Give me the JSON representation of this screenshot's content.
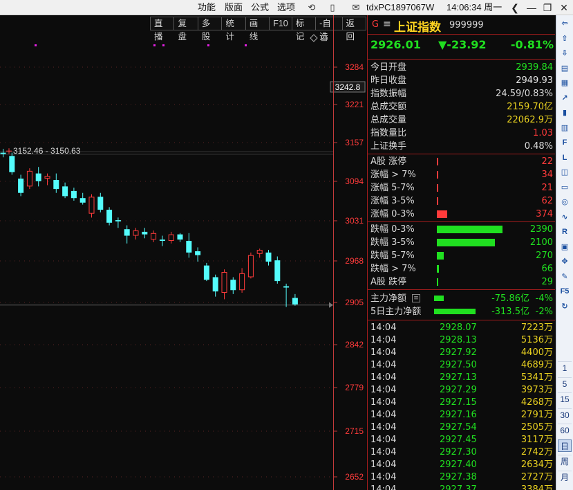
{
  "topbar": {
    "menus": [
      "功能",
      "版面",
      "公式",
      "选项"
    ],
    "account": "tdxPC1897067W",
    "clock": "14:06:34 周一"
  },
  "toolbar": [
    "直播",
    "复盘",
    "多股",
    "统计",
    "画线",
    "F10",
    "标记",
    "-自选",
    "返回"
  ],
  "chart": {
    "price_label": "3152.46 - 3150.63",
    "current_price_tag": "3242.8",
    "y_ticks": [
      "3284",
      "3221",
      "3157",
      "3094",
      "3031",
      "2968",
      "2905",
      "2842",
      "2779",
      "2715",
      "2652"
    ]
  },
  "chart_data": {
    "type": "candlestick",
    "title": "",
    "ylim": [
      2630,
      3330
    ],
    "y_ticks": [
      3284,
      3221,
      3157,
      3094,
      3031,
      2968,
      2905,
      2842,
      2779,
      2715,
      2652
    ],
    "reference_lines": [
      3152.46,
      3150.63,
      2917
    ],
    "candles": [
      {
        "o": 3152,
        "h": 3158,
        "l": 3145,
        "c": 3150
      },
      {
        "o": 3147,
        "h": 3152,
        "l": 3118,
        "c": 3122
      },
      {
        "o": 3112,
        "h": 3118,
        "l": 3085,
        "c": 3090
      },
      {
        "o": 3100,
        "h": 3128,
        "l": 3096,
        "c": 3124
      },
      {
        "o": 3120,
        "h": 3130,
        "l": 3100,
        "c": 3108
      },
      {
        "o": 3112,
        "h": 3120,
        "l": 3102,
        "c": 3116
      },
      {
        "o": 3110,
        "h": 3120,
        "l": 3090,
        "c": 3096
      },
      {
        "o": 3100,
        "h": 3106,
        "l": 3082,
        "c": 3085
      },
      {
        "o": 3093,
        "h": 3098,
        "l": 3078,
        "c": 3082
      },
      {
        "o": 3082,
        "h": 3090,
        "l": 3072,
        "c": 3075
      },
      {
        "o": 3058,
        "h": 3088,
        "l": 3052,
        "c": 3084
      },
      {
        "o": 3084,
        "h": 3090,
        "l": 3060,
        "c": 3064
      },
      {
        "o": 3064,
        "h": 3068,
        "l": 3040,
        "c": 3044
      },
      {
        "o": 3048,
        "h": 3052,
        "l": 3036,
        "c": 3046
      },
      {
        "o": 3034,
        "h": 3040,
        "l": 3012,
        "c": 3024
      },
      {
        "o": 3024,
        "h": 3036,
        "l": 3018,
        "c": 3032
      },
      {
        "o": 3030,
        "h": 3036,
        "l": 3020,
        "c": 3026
      },
      {
        "o": 3018,
        "h": 3032,
        "l": 3014,
        "c": 3028
      },
      {
        "o": 3018,
        "h": 3024,
        "l": 3008,
        "c": 3016
      },
      {
        "o": 3016,
        "h": 3030,
        "l": 3012,
        "c": 3026
      },
      {
        "o": 3026,
        "h": 3028,
        "l": 3014,
        "c": 3018
      },
      {
        "o": 3016,
        "h": 3028,
        "l": 2990,
        "c": 2998
      },
      {
        "o": 3000,
        "h": 3006,
        "l": 2984,
        "c": 2994
      },
      {
        "o": 2978,
        "h": 2982,
        "l": 2954,
        "c": 2956
      },
      {
        "o": 2960,
        "h": 2964,
        "l": 2930,
        "c": 2938
      },
      {
        "o": 2936,
        "h": 2972,
        "l": 2926,
        "c": 2968
      },
      {
        "o": 2956,
        "h": 2960,
        "l": 2934,
        "c": 2940
      },
      {
        "o": 2940,
        "h": 2974,
        "l": 2936,
        "c": 2966
      },
      {
        "o": 2960,
        "h": 2998,
        "l": 2958,
        "c": 2994
      },
      {
        "o": 2996,
        "h": 3004,
        "l": 2990,
        "c": 3002
      },
      {
        "o": 2998,
        "h": 3002,
        "l": 2978,
        "c": 2984
      },
      {
        "o": 2986,
        "h": 2992,
        "l": 2950,
        "c": 2954
      },
      {
        "o": 2946,
        "h": 2950,
        "l": 2914,
        "c": 2944
      },
      {
        "o": 2928,
        "h": 2934,
        "l": 2916,
        "c": 2918
      }
    ],
    "colors": {
      "up": "#ff3b3b",
      "down": "#54fcfc",
      "grid": "#5a2424"
    }
  },
  "quote": {
    "mark": "G",
    "name": "上证指数",
    "code": "999999",
    "price": "2926.01",
    "change": "▼-23.92",
    "change_pct": "-0.81%"
  },
  "stats": [
    {
      "label": "今日开盘",
      "value": "2939.84",
      "color": "#20e020"
    },
    {
      "label": "昨日收盘",
      "value": "2949.93",
      "color": "#e6e6e6"
    },
    {
      "label": "指数振幅",
      "value": "24.59/0.83%",
      "color": "#d8d8d8"
    },
    {
      "label": "总成交额",
      "value": "2159.70亿",
      "color": "#e8d020"
    },
    {
      "label": "总成交量",
      "value": "22062.9万",
      "color": "#e8d020"
    },
    {
      "label": "指数量比",
      "value": "1.03",
      "color": "#ff3b3b"
    },
    {
      "label": "上证换手",
      "value": "0.48%",
      "color": "#d8d8d8"
    }
  ],
  "breadth_up": [
    {
      "label": "A股 涨停",
      "value": "22",
      "bar": 0.006
    },
    {
      "label": "涨幅 > 7%",
      "value": "34",
      "bar": 0.009
    },
    {
      "label": "涨幅 5-7%",
      "value": "21",
      "bar": 0.006
    },
    {
      "label": "涨幅 3-5%",
      "value": "62",
      "bar": 0.02
    },
    {
      "label": "涨幅 0-3%",
      "value": "374",
      "bar": 0.16
    }
  ],
  "breadth_down": [
    {
      "label": "跌幅 0-3%",
      "value": "2390",
      "bar": 1.0
    },
    {
      "label": "跌幅 3-5%",
      "value": "2100",
      "bar": 0.88
    },
    {
      "label": "跌幅 5-7%",
      "value": "270",
      "bar": 0.11
    },
    {
      "label": "跌幅 > 7%",
      "value": "66",
      "bar": 0.03
    },
    {
      "label": "A股 跌停",
      "value": "29",
      "bar": 0.01
    }
  ],
  "capital": [
    {
      "label": "主力净额",
      "value": "-75.86亿",
      "pct": "-4%",
      "bar": 0.2
    },
    {
      "label": "5日主力净额",
      "value": "-313.5亿",
      "pct": "-2%",
      "bar": 0.85
    }
  ],
  "ticks": [
    {
      "time": "14:04",
      "price": "2928.07",
      "vol": "7223万"
    },
    {
      "time": "14:04",
      "price": "2928.13",
      "vol": "5136万"
    },
    {
      "time": "14:04",
      "price": "2927.92",
      "vol": "4400万"
    },
    {
      "time": "14:04",
      "price": "2927.50",
      "vol": "4689万"
    },
    {
      "time": "14:04",
      "price": "2927.13",
      "vol": "5341万"
    },
    {
      "time": "14:04",
      "price": "2927.29",
      "vol": "3973万"
    },
    {
      "time": "14:04",
      "price": "2927.15",
      "vol": "4268万"
    },
    {
      "time": "14:04",
      "price": "2927.16",
      "vol": "2791万"
    },
    {
      "time": "14:04",
      "price": "2927.54",
      "vol": "2505万"
    },
    {
      "time": "14:04",
      "price": "2927.45",
      "vol": "3117万"
    },
    {
      "time": "14:04",
      "price": "2927.30",
      "vol": "2742万"
    },
    {
      "time": "14:04",
      "price": "2927.40",
      "vol": "2634万"
    },
    {
      "time": "14:04",
      "price": "2927.38",
      "vol": "2727万"
    },
    {
      "time": "14:04",
      "price": "2927.37",
      "vol": "3384万"
    }
  ],
  "sidebar": {
    "icons": [
      "arrow-left-icon",
      "arrow-up-icon",
      "arrow-down-icon",
      "news-icon",
      "table-icon",
      "line-chart-icon",
      "candle-chart-icon",
      "grid-icon",
      "f10-icon",
      "level2-icon",
      "chart-icon",
      "book-icon",
      "search-icon",
      "wave-icon",
      "rsi-icon",
      "calendar-icon",
      "move-icon",
      "pen-icon",
      "f5-icon",
      "refresh-icon"
    ],
    "periods": [
      "1",
      "5",
      "15",
      "30",
      "60",
      "日",
      "周",
      "月"
    ]
  }
}
